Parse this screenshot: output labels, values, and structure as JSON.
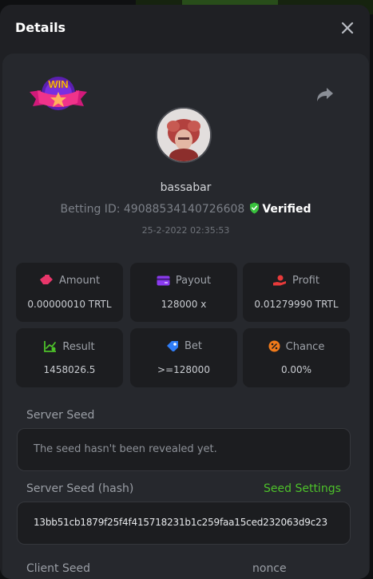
{
  "modal": {
    "title": "Details",
    "close_label": "×"
  },
  "badge": {
    "text": "WIN"
  },
  "user": {
    "name": "bassabar",
    "betting_id_text": "Betting ID: 49088534140726608",
    "verified_label": "Verified",
    "date": "25-2-2022 02:35:53"
  },
  "stats": [
    {
      "label": "Amount",
      "value": "0.00000010 TRTL",
      "icon": "wallet-hand-icon",
      "color": "#e8366a"
    },
    {
      "label": "Payout",
      "value": "128000 x",
      "icon": "card-icon",
      "color": "#8b3bf0"
    },
    {
      "label": "Profit",
      "value": "0.01279990 TRTL",
      "icon": "hand-coin-icon",
      "color": "#e73a3a"
    },
    {
      "label": "Result",
      "value": "1458026.5",
      "icon": "chart-icon",
      "color": "#4dc12a"
    },
    {
      "label": "Bet",
      "value": ">=128000",
      "icon": "ticket-icon",
      "color": "#2f7df6"
    },
    {
      "label": "Chance",
      "value": "0.00%",
      "icon": "percent-icon",
      "color": "#f07a1a"
    }
  ],
  "server_seed": {
    "label": "Server Seed",
    "value": "The seed hasn't been revealed yet."
  },
  "server_seed_hash": {
    "label": "Server Seed (hash)",
    "settings_link": "Seed Settings",
    "value": "13bb51cb1879f25f4f415718231b1c259faa15ced232063d9c23"
  },
  "client_seed": {
    "label": "Client Seed",
    "nonce_label": "nonce"
  }
}
